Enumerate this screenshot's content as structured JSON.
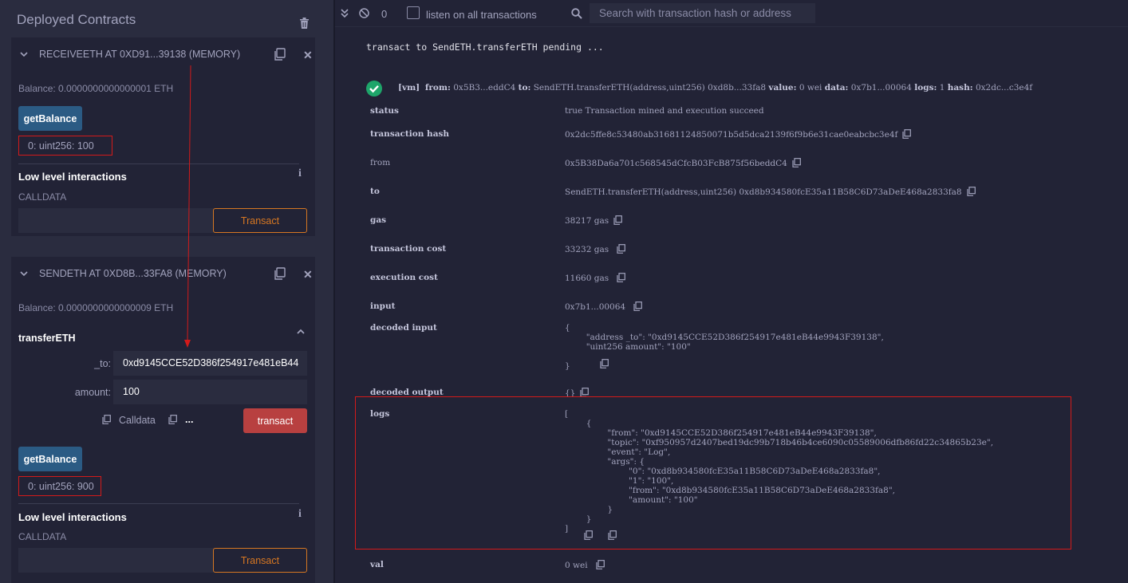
{
  "left_panel": {
    "title": "Deployed Contracts",
    "contracts": [
      {
        "name": "RECEIVEETH AT 0XD91...39138 (MEMORY)",
        "balance": "Balance: 0.0000000000000001 ETH",
        "getbalance_label": "getBalance",
        "getbalance_output": "0: uint256: 100",
        "low_level_label": "Low level interactions",
        "calldata_label": "CALLDATA",
        "transact_label": "Transact"
      },
      {
        "name": "SENDETH AT 0XD8B...33FA8 (MEMORY)",
        "balance": "Balance: 0.0000000000000009 ETH",
        "function_name": "transferETH",
        "param_to_label": "_to:",
        "param_to_value": "0xd9145CCE52D386f254917e481eB44",
        "param_amount_label": "amount:",
        "param_amount_value": "100",
        "calldata_link": "Calldata",
        "more": "...",
        "transact_red_label": "transact",
        "getbalance_label": "getBalance",
        "getbalance_output": "0: uint256: 900",
        "low_level_label": "Low level interactions",
        "calldata_label": "CALLDATA",
        "transact_label": "Transact"
      }
    ]
  },
  "terminal": {
    "counter": "0",
    "listen_label": "listen on all transactions",
    "search_placeholder": "Search with transaction hash or address",
    "pending": "transact to SendETH.transferETH pending ...",
    "tx_summary": {
      "vm": "[vm]",
      "from_k": "from:",
      "from_v": "0x5B3...eddC4",
      "to_k": "to:",
      "to_v": "SendETH.transferETH(address,uint256) 0xd8b...33fa8",
      "value_k": "value:",
      "value_v": "0 wei",
      "data_k": "data:",
      "data_v": "0x7b1...00064",
      "logs_k": "logs:",
      "logs_v": "1",
      "hash_k": "hash:",
      "hash_v": "0x2dc...c3e4f"
    },
    "rows": {
      "status_k": "status",
      "status_v": "true Transaction mined and execution succeed",
      "hash_k": "transaction hash",
      "hash_v": "0x2dc5ffe8c53480ab31681124850071b5d5dca2139f6f9b6e31cae0eabcbc3e4f",
      "from_k": "from",
      "from_v": "0x5B38Da6a701c568545dCfcB03FcB875f56beddC4",
      "to_k": "to",
      "to_v": "SendETH.transferETH(address,uint256) 0xd8b934580fcE35a11B58C6D73aDeE468a2833fa8",
      "gas_k": "gas",
      "gas_v": "38217 gas",
      "tcost_k": "transaction cost",
      "tcost_v": "33232 gas",
      "ecost_k": "execution cost",
      "ecost_v": "11660 gas",
      "input_k": "input",
      "input_v": "0x7b1...00064",
      "dinput_k": "decoded input",
      "dinput_v": "{\n        \"address _to\": \"0xd9145CCE52D386f254917e481eB44e9943F39138\",\n        \"uint256 amount\": \"100\"\n\n}",
      "doutput_k": "decoded output",
      "doutput_v": "{}",
      "logs_k": "logs",
      "logs_v": "[\n        {\n                \"from\": \"0xd9145CCE52D386f254917e481eB44e9943F39138\",\n                \"topic\": \"0xf950957d2407bed19dc99b718b46b4ce6090c05589006dfb86fd22c34865b23e\",\n                \"event\": \"Log\",\n                \"args\": {\n                        \"0\": \"0xd8b934580fcE35a11B58C6D73aDeE468a2833fa8\",\n                        \"1\": \"100\",\n                        \"from\": \"0xd8b934580fcE35a11B58C6D73aDeE468a2833fa8\",\n                        \"amount\": \"100\"\n                }\n        }\n]",
      "val_k": "val",
      "val_v": "0 wei"
    }
  },
  "colors": {
    "accent_orange": "#d67722",
    "button_blue": "#2b5b84",
    "button_red": "#b84040",
    "highlight_red": "#d31a1a",
    "success_green": "#1ea56a"
  }
}
